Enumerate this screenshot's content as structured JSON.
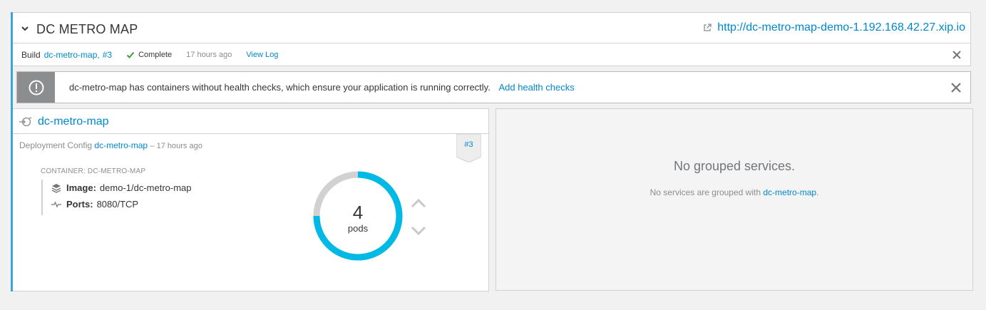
{
  "app": {
    "title": "DC METRO MAP",
    "route_url": "http://dc-metro-map-demo-1.192.168.42.27.xip.io"
  },
  "build": {
    "label": "Build",
    "name": "dc-metro-map",
    "separator": ",",
    "number": "#3",
    "status": "Complete",
    "time_ago": "17 hours ago",
    "view_log": "View Log"
  },
  "alert": {
    "message": "dc-metro-map has containers without health checks, which ensure your application is running correctly.",
    "action": "Add health checks"
  },
  "deployment": {
    "name": "dc-metro-map",
    "config_label": "Deployment Config",
    "config_name": "dc-metro-map",
    "time_ago": "– 17 hours ago",
    "badge": "#3",
    "container_label": "CONTAINER: DC-METRO-MAP",
    "image_label": "Image:",
    "image_value": "demo-1/dc-metro-map",
    "ports_label": "Ports:",
    "ports_value": "8080/TCP",
    "pods_count": "4",
    "pods_unit": "pods"
  },
  "services": {
    "title": "No grouped services.",
    "desc_prefix": "No services are grouped with",
    "desc_link": "dc-metro-map",
    "desc_suffix": "."
  },
  "colors": {
    "accent": "#39a5dc",
    "link": "#0088ce",
    "success": "#3f9c35",
    "donut_ring": "#00b9e4",
    "donut_track": "#d1d1d1"
  }
}
